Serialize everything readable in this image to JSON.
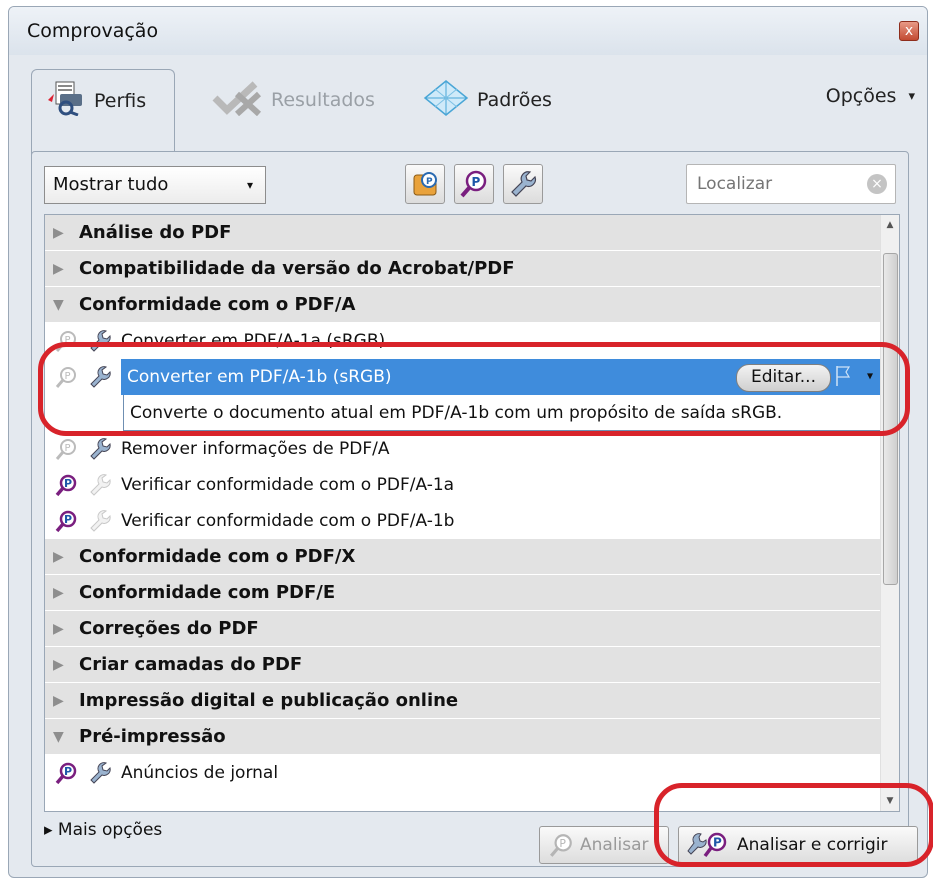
{
  "window": {
    "title": "Comprovação",
    "close_glyph": "x"
  },
  "tabs": [
    {
      "label": "Perfis",
      "icon": "preflight-profiles-icon",
      "active": true
    },
    {
      "label": "Resultados",
      "icon": "results-check-icon",
      "disabled": true
    },
    {
      "label": "Padrões",
      "icon": "standards-diamond-icon"
    }
  ],
  "options_menu": {
    "label": "Opções",
    "glyph": "▾"
  },
  "toolbar": {
    "filter_select": "Mostrar tudo",
    "filter_arrow": "▾",
    "search_placeholder": "Localizar",
    "clear_glyph": "×"
  },
  "list": {
    "expand_glyph": "▶",
    "collapse_glyph": "▼",
    "rows": [
      {
        "type": "category",
        "label": "Análise do PDF",
        "expanded": false
      },
      {
        "type": "category",
        "label": "Compatibilidade da versão do Acrobat/PDF",
        "expanded": false
      },
      {
        "type": "category",
        "label": "Conformidade com o PDF/A",
        "expanded": true
      },
      {
        "type": "item",
        "label": "Converter em PDF/A-1a (sRGB)",
        "analyze_icon": "faded",
        "fix_icon": "active"
      },
      {
        "type": "item",
        "label": "Converter em PDF/A-1b (sRGB)",
        "selected": true,
        "analyze_icon": "faded",
        "fix_icon": "active"
      },
      {
        "type": "item",
        "label": "Remover informações de PDF/A",
        "analyze_icon": "faded",
        "fix_icon": "active"
      },
      {
        "type": "item",
        "label": "Verificar conformidade com o PDF/A-1a",
        "analyze_icon": "active",
        "fix_icon": "faded"
      },
      {
        "type": "item",
        "label": "Verificar conformidade com o PDF/A-1b",
        "analyze_icon": "active",
        "fix_icon": "faded"
      },
      {
        "type": "category",
        "label": "Conformidade com o PDF/X",
        "expanded": false
      },
      {
        "type": "category",
        "label": "Conformidade com PDF/E",
        "expanded": false
      },
      {
        "type": "category",
        "label": "Correções do PDF",
        "expanded": false
      },
      {
        "type": "category",
        "label": "Criar camadas do PDF",
        "expanded": false
      },
      {
        "type": "category",
        "label": "Impressão digital e publicação online",
        "expanded": false
      },
      {
        "type": "category",
        "label": "Pré-impressão",
        "expanded": true
      },
      {
        "type": "item",
        "label": "Anúncios de jornal",
        "analyze_icon": "active",
        "fix_icon": "active"
      }
    ],
    "selected_description": "Converte o documento atual em PDF/A-1b com um propósito de saída sRGB.",
    "edit_button": "Editar...",
    "flag_glyph": "▾",
    "scroll_up": "▲",
    "scroll_down": "▼"
  },
  "footer": {
    "more_options": "▸ Mais opções",
    "analyze_button": "Analisar",
    "analyze_fix_button": "Analisar e corrigir"
  },
  "colors": {
    "selection": "#3f8cdc",
    "annotation": "#d8232a"
  }
}
